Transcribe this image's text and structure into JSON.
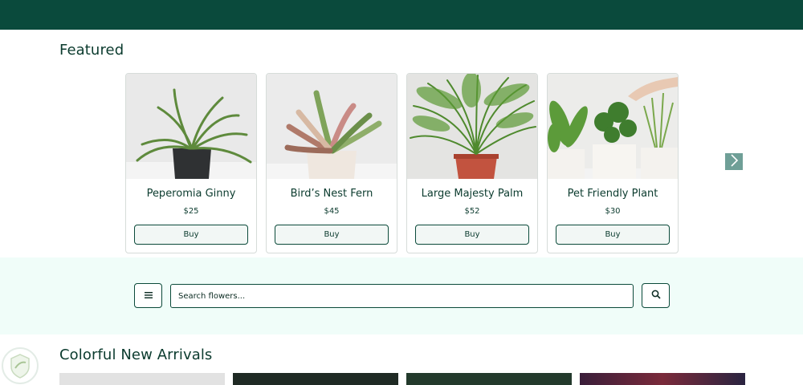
{
  "header": {
    "color": "#0a4a3c"
  },
  "featured": {
    "title": "Featured",
    "products": [
      {
        "name": "Peperomia Ginny",
        "price": "$25",
        "buy_label": "Buy"
      },
      {
        "name": "Bird’s Nest Fern",
        "price": "$45",
        "buy_label": "Buy"
      },
      {
        "name": "Large Majesty Palm",
        "price": "$52",
        "buy_label": "Buy"
      },
      {
        "name": "Pet Friendly Plant",
        "price": "$30",
        "buy_label": "Buy"
      }
    ],
    "next_icon": "chevron-right-icon"
  },
  "search": {
    "placeholder": "Search flowers...",
    "menu_icon": "hamburger-menu-icon",
    "search_icon": "magnifier-icon",
    "band_color": "#f0fdf9"
  },
  "arrivals": {
    "title": "Colorful New Arrivals"
  },
  "colors": {
    "brand_dark": "#0a4a3c",
    "accent_arrow": "#6f9f97"
  }
}
